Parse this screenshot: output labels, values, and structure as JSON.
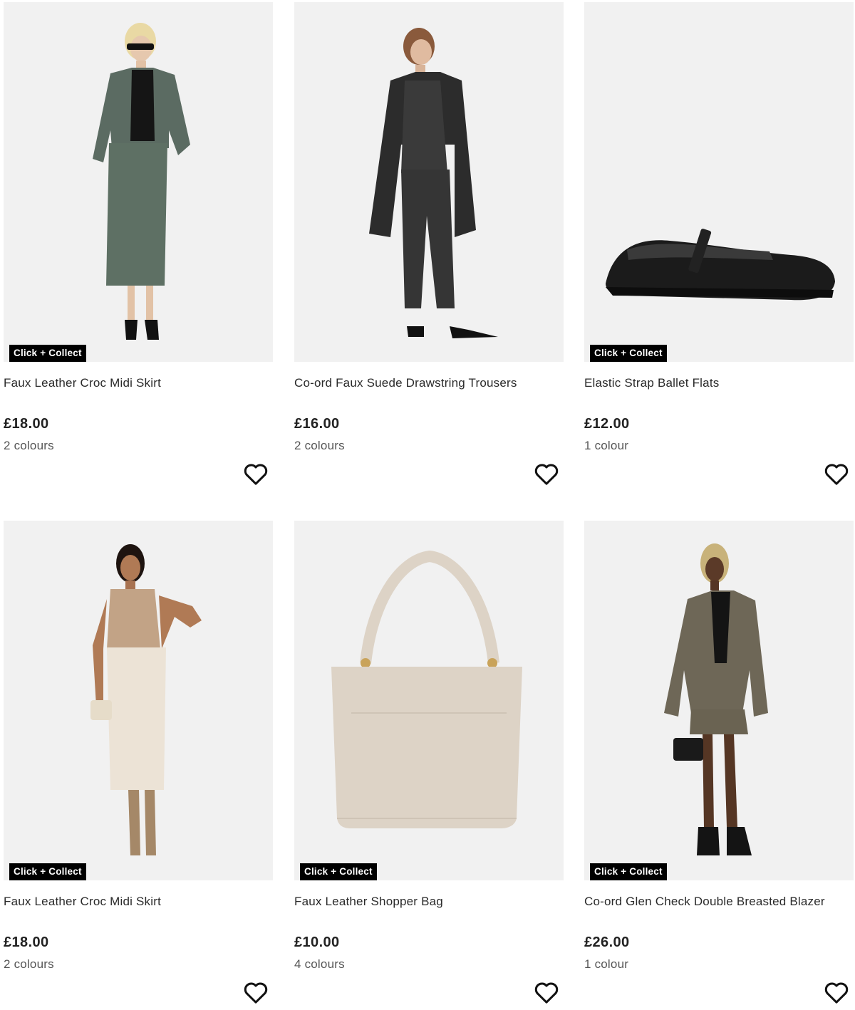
{
  "products": [
    {
      "name": "Faux Leather Croc Midi Skirt",
      "price": "£18.00",
      "colours": "2 colours",
      "badge": "Click + Collect"
    },
    {
      "name": "Co-ord Faux Suede Drawstring Trousers",
      "price": "£16.00",
      "colours": "2 colours",
      "badge": ""
    },
    {
      "name": "Elastic Strap Ballet Flats",
      "price": "£12.00",
      "colours": "1 colour",
      "badge": "Click + Collect"
    },
    {
      "name": "Faux Leather Croc Midi Skirt",
      "price": "£18.00",
      "colours": "2 colours",
      "badge": "Click + Collect"
    },
    {
      "name": "Faux Leather Shopper Bag",
      "price": "£10.00",
      "colours": "4 colours",
      "badge": "Click + Collect"
    },
    {
      "name": "Co-ord Glen Check Double Breasted Blazer",
      "price": "£26.00",
      "colours": "1 colour",
      "badge": "Click + Collect"
    }
  ],
  "icons": {
    "wishlist": "heart-outline-icon"
  }
}
